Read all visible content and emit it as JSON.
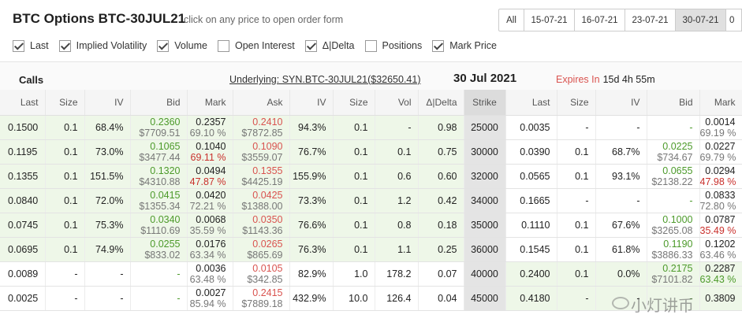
{
  "header": {
    "title": "BTC Options BTC-30JUL21",
    "subtitle": "click on any price to open order form",
    "tabs": [
      {
        "label": "All",
        "active": false
      },
      {
        "label": "15-07-21",
        "active": false
      },
      {
        "label": "16-07-21",
        "active": false
      },
      {
        "label": "23-07-21",
        "active": false
      },
      {
        "label": "30-07-21",
        "active": true
      },
      {
        "label": "0",
        "active": false
      }
    ]
  },
  "toggles": [
    {
      "label": "Last",
      "checked": true
    },
    {
      "label": "Implied Volatility",
      "checked": true
    },
    {
      "label": "Volume",
      "checked": true
    },
    {
      "label": "Open Interest",
      "checked": false
    },
    {
      "label": "Δ|Delta",
      "checked": true
    },
    {
      "label": "Positions",
      "checked": false
    },
    {
      "label": "Mark Price",
      "checked": true
    }
  ],
  "info": {
    "calls_label": "Calls",
    "underlying": "Underlying: SYN.BTC-30JUL21($32650.41)",
    "date": "30 Jul 2021",
    "expires_label": "Expires In",
    "expires_value": "15d 4h 55m"
  },
  "columns": [
    "Last",
    "Size",
    "IV",
    "Bid",
    "Mark",
    "Ask",
    "IV",
    "Size",
    "Vol",
    "Δ|Delta",
    "Strike",
    "Last",
    "Size",
    "IV",
    "Bid",
    "Mark"
  ],
  "rows": [
    {
      "c_last": "0.1500",
      "c_size": "0.1",
      "c_iv": "68.4%",
      "c_bid": "0.2360",
      "c_bid_sub": "$7709.51",
      "c_mark": "0.2357",
      "c_mark_sub": "69.10 %",
      "c_ask": "0.2410",
      "c_ask_sub": "$7872.85",
      "c_askiv": "94.3%",
      "c_asksize": "0.1",
      "c_vol": "-",
      "c_delta": "0.98",
      "strike": "25000",
      "p_last": "0.0035",
      "p_size": "-",
      "p_iv": "-",
      "p_bid": "-",
      "p_bid_sub": "",
      "p_mark": "0.0014",
      "p_mark_sub": "69.19 %"
    },
    {
      "c_last": "0.1195",
      "c_size": "0.1",
      "c_iv": "73.0%",
      "c_bid": "0.1065",
      "c_bid_sub": "$3477.44",
      "c_mark": "0.1040",
      "c_mark_sub": "69.11 %",
      "c_ask": "0.1090",
      "c_ask_sub": "$3559.07",
      "c_askiv": "76.7%",
      "c_asksize": "0.1",
      "c_vol": "0.1",
      "c_delta": "0.75",
      "strike": "30000",
      "p_last": "0.0390",
      "p_size": "0.1",
      "p_iv": "68.7%",
      "p_bid": "0.0225",
      "p_bid_sub": "$734.67",
      "p_mark": "0.0227",
      "p_mark_sub": "69.79 %"
    },
    {
      "c_last": "0.1355",
      "c_size": "0.1",
      "c_iv": "151.5%",
      "c_bid": "0.1320",
      "c_bid_sub": "$4310.88",
      "c_mark": "0.0494",
      "c_mark_sub": "47.87 %",
      "c_ask": "0.1355",
      "c_ask_sub": "$4425.19",
      "c_askiv": "155.9%",
      "c_asksize": "0.1",
      "c_vol": "0.6",
      "c_delta": "0.60",
      "strike": "32000",
      "p_last": "0.0565",
      "p_size": "0.1",
      "p_iv": "93.1%",
      "p_bid": "0.0655",
      "p_bid_sub": "$2138.22",
      "p_mark": "0.0294",
      "p_mark_sub": "47.98 %"
    },
    {
      "c_last": "0.0840",
      "c_size": "0.1",
      "c_iv": "72.0%",
      "c_bid": "0.0415",
      "c_bid_sub": "$1355.34",
      "c_mark": "0.0420",
      "c_mark_sub": "72.21 %",
      "c_ask": "0.0425",
      "c_ask_sub": "$1388.00",
      "c_askiv": "73.3%",
      "c_asksize": "0.1",
      "c_vol": "1.2",
      "c_delta": "0.42",
      "strike": "34000",
      "p_last": "0.1665",
      "p_size": "-",
      "p_iv": "-",
      "p_bid": "-",
      "p_bid_sub": "",
      "p_mark": "0.0833",
      "p_mark_sub": "72.80 %"
    },
    {
      "c_last": "0.0745",
      "c_size": "0.1",
      "c_iv": "75.3%",
      "c_bid": "0.0340",
      "c_bid_sub": "$1110.69",
      "c_mark": "0.0068",
      "c_mark_sub": "35.59 %",
      "c_ask": "0.0350",
      "c_ask_sub": "$1143.36",
      "c_askiv": "76.6%",
      "c_asksize": "0.1",
      "c_vol": "0.8",
      "c_delta": "0.18",
      "strike": "35000",
      "p_last": "0.1110",
      "p_size": "0.1",
      "p_iv": "67.6%",
      "p_bid": "0.1000",
      "p_bid_sub": "$3265.08",
      "p_mark": "0.0787",
      "p_mark_sub": "35.49 %"
    },
    {
      "c_last": "0.0695",
      "c_size": "0.1",
      "c_iv": "74.9%",
      "c_bid": "0.0255",
      "c_bid_sub": "$833.02",
      "c_mark": "0.0176",
      "c_mark_sub": "63.34 %",
      "c_ask": "0.0265",
      "c_ask_sub": "$865.69",
      "c_askiv": "76.3%",
      "c_asksize": "0.1",
      "c_vol": "1.1",
      "c_delta": "0.25",
      "strike": "36000",
      "p_last": "0.1545",
      "p_size": "0.1",
      "p_iv": "61.8%",
      "p_bid": "0.1190",
      "p_bid_sub": "$3886.33",
      "p_mark": "0.1202",
      "p_mark_sub": "63.46 %"
    },
    {
      "c_last": "0.0089",
      "c_size": "-",
      "c_iv": "-",
      "c_bid": "-",
      "c_bid_sub": "",
      "c_mark": "0.0036",
      "c_mark_sub": "63.48 %",
      "c_ask": "0.0105",
      "c_ask_sub": "$342.85",
      "c_askiv": "82.9%",
      "c_asksize": "1.0",
      "c_vol": "178.2",
      "c_delta": "0.07",
      "strike": "40000",
      "p_last": "0.2400",
      "p_size": "0.1",
      "p_iv": "0.0%",
      "p_bid": "0.2175",
      "p_bid_sub": "$7101.82",
      "p_mark": "0.2287",
      "p_mark_sub": "63.43 %"
    },
    {
      "c_last": "0.0025",
      "c_size": "-",
      "c_iv": "-",
      "c_bid": "-",
      "c_bid_sub": "",
      "c_mark": "0.0027",
      "c_mark_sub": "85.94 %",
      "c_ask": "0.2415",
      "c_ask_sub": "$7889.18",
      "c_askiv": "432.9%",
      "c_asksize": "10.0",
      "c_vol": "126.4",
      "c_delta": "0.04",
      "strike": "45000",
      "p_last": "0.4180",
      "p_size": "-",
      "p_iv": "-",
      "p_bid": "-",
      "p_bid_sub": "",
      "p_mark": "0.3809",
      "p_mark_sub": ""
    }
  ],
  "watermark": "小灯讲币",
  "colors": {
    "bid": "#4c9a2a",
    "ask": "#d9534f",
    "itm_bg": "#eef7e8",
    "strike_bg": "#e4e4e4"
  }
}
